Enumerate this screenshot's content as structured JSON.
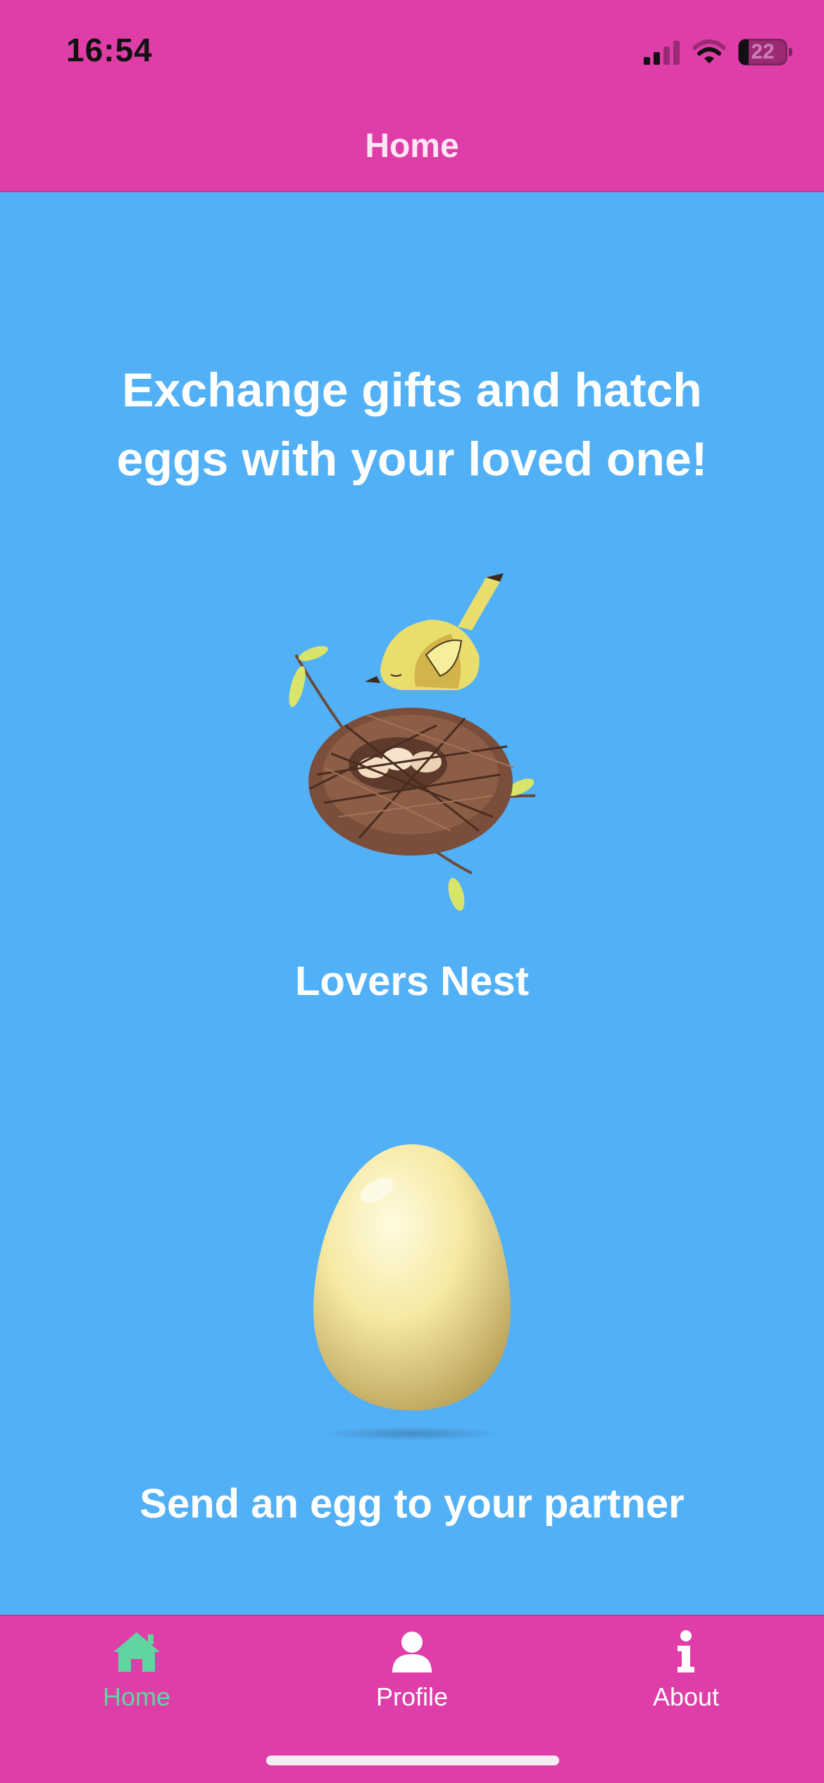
{
  "status_bar": {
    "time": "16:54",
    "battery": "22",
    "icons": [
      "cellular-signal-icon",
      "wifi-icon",
      "battery-icon"
    ]
  },
  "header": {
    "title": "Home"
  },
  "main": {
    "headline": "Exchange gifts and hatch eggs with your loved one!",
    "nest_title": "Lovers Nest",
    "egg_cta": "Send an egg to your partner"
  },
  "tab_bar": {
    "items": [
      {
        "label": "Home",
        "icon": "home-icon",
        "active": true
      },
      {
        "label": "Profile",
        "icon": "person-icon",
        "active": false
      },
      {
        "label": "About",
        "icon": "info-icon",
        "active": false
      }
    ]
  },
  "colors": {
    "header_background": "#df3da8",
    "page_background": "#52b0f6",
    "active_tab": "#5fd6a0",
    "text": "#ffffff"
  }
}
